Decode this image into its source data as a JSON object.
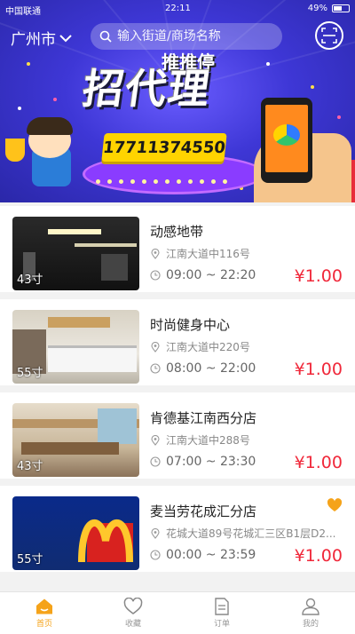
{
  "status_bar": {
    "carrier": "中国联通",
    "time": "22:11",
    "battery": "49%"
  },
  "header": {
    "city": "广州市",
    "search_placeholder": "输入街道/商场名称"
  },
  "banner": {
    "headline_small": "推推停",
    "headline_big": "招代理",
    "phone": "17711374550"
  },
  "venues": [
    {
      "name": "动感地带",
      "address": "江南大道中116号",
      "hours": "09:00 ~ 22:20",
      "price": "¥1.00",
      "size": "43寸",
      "favorite": false
    },
    {
      "name": "时尚健身中心",
      "address": "江南大道中220号",
      "hours": "08:00 ~ 22:00",
      "price": "¥1.00",
      "size": "55寸",
      "favorite": false
    },
    {
      "name": "肯德基江南西分店",
      "address": "江南大道中288号",
      "hours": "07:00 ~ 23:30",
      "price": "¥1.00",
      "size": "43寸",
      "favorite": false
    },
    {
      "name": "麦当劳花成汇分店",
      "address": "花城大道89号花城汇三区B1层D2...",
      "hours": "00:00 ~ 23:59",
      "price": "¥1.00",
      "size": "55寸",
      "favorite": true
    }
  ],
  "tabs": [
    {
      "label": "首页",
      "icon": "home-icon",
      "active": true
    },
    {
      "label": "收藏",
      "icon": "heart-icon",
      "active": false
    },
    {
      "label": "订单",
      "icon": "order-icon",
      "active": false
    },
    {
      "label": "我的",
      "icon": "user-icon",
      "active": false
    }
  ],
  "colors": {
    "accent": "#f5a31a",
    "price": "#f0283a",
    "banner": "#3e37d6",
    "phone_bg": "#ffd400"
  }
}
